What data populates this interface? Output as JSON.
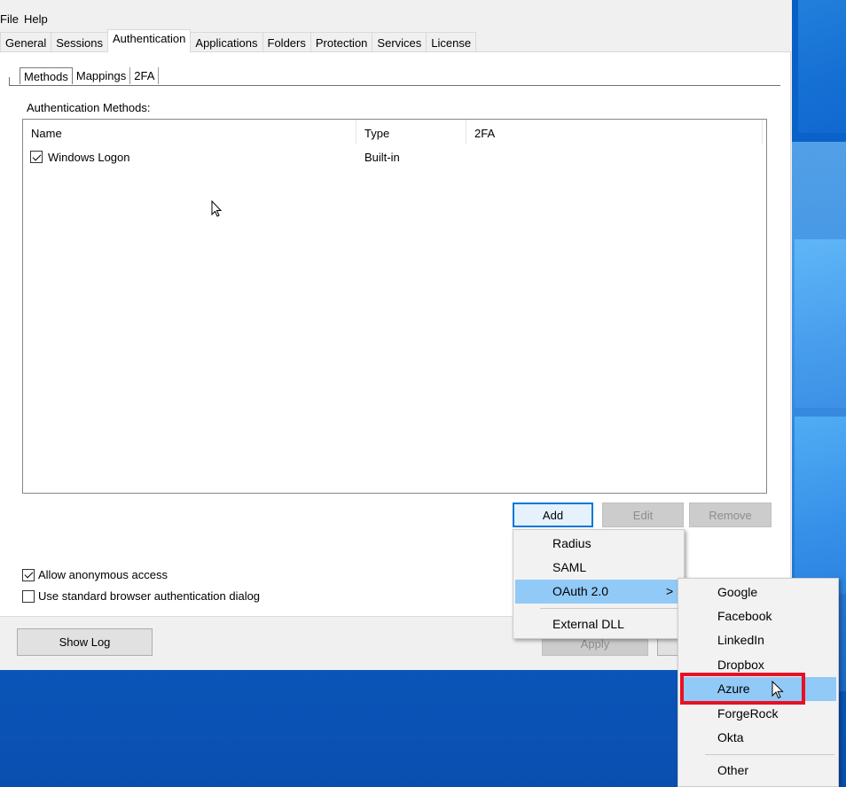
{
  "menubar": {
    "file": "File",
    "help": "Help"
  },
  "top_tabs": [
    {
      "label": "General"
    },
    {
      "label": "Sessions"
    },
    {
      "label": "Authentication"
    },
    {
      "label": "Applications"
    },
    {
      "label": "Folders"
    },
    {
      "label": "Protection"
    },
    {
      "label": "Services"
    },
    {
      "label": "License"
    }
  ],
  "sub_tabs": [
    {
      "label": "Methods"
    },
    {
      "label": "Mappings"
    },
    {
      "label": "2FA"
    }
  ],
  "methods": {
    "section_label": "Authentication Methods:",
    "columns": [
      "Name",
      "Type",
      "2FA"
    ],
    "rows": [
      {
        "checked": true,
        "name": "Windows Logon",
        "type": "Built-in",
        "twofa": ""
      }
    ]
  },
  "buttons": {
    "add": "Add",
    "edit": "Edit",
    "remove": "Remove",
    "show_log": "Show Log",
    "apply": "Apply"
  },
  "options": {
    "allow_anonymous": {
      "label": "Allow anonymous access",
      "checked": true
    },
    "standard_browser_dialog": {
      "label": "Use standard browser authentication dialog",
      "checked": false
    }
  },
  "add_menu": {
    "items": [
      "Radius",
      "SAML",
      "OAuth 2.0",
      "External DLL"
    ],
    "submenu_arrow": ">"
  },
  "oauth_submenu": {
    "items": [
      "Google",
      "Facebook",
      "LinkedIn",
      "Dropbox",
      "Azure",
      "ForgeRock",
      "Okta",
      "Other"
    ],
    "highlighted": "Azure"
  },
  "colors": {
    "menu_highlight": "#91c9f7",
    "annotation_box": "#e81123",
    "focus_border": "#0078d7"
  }
}
